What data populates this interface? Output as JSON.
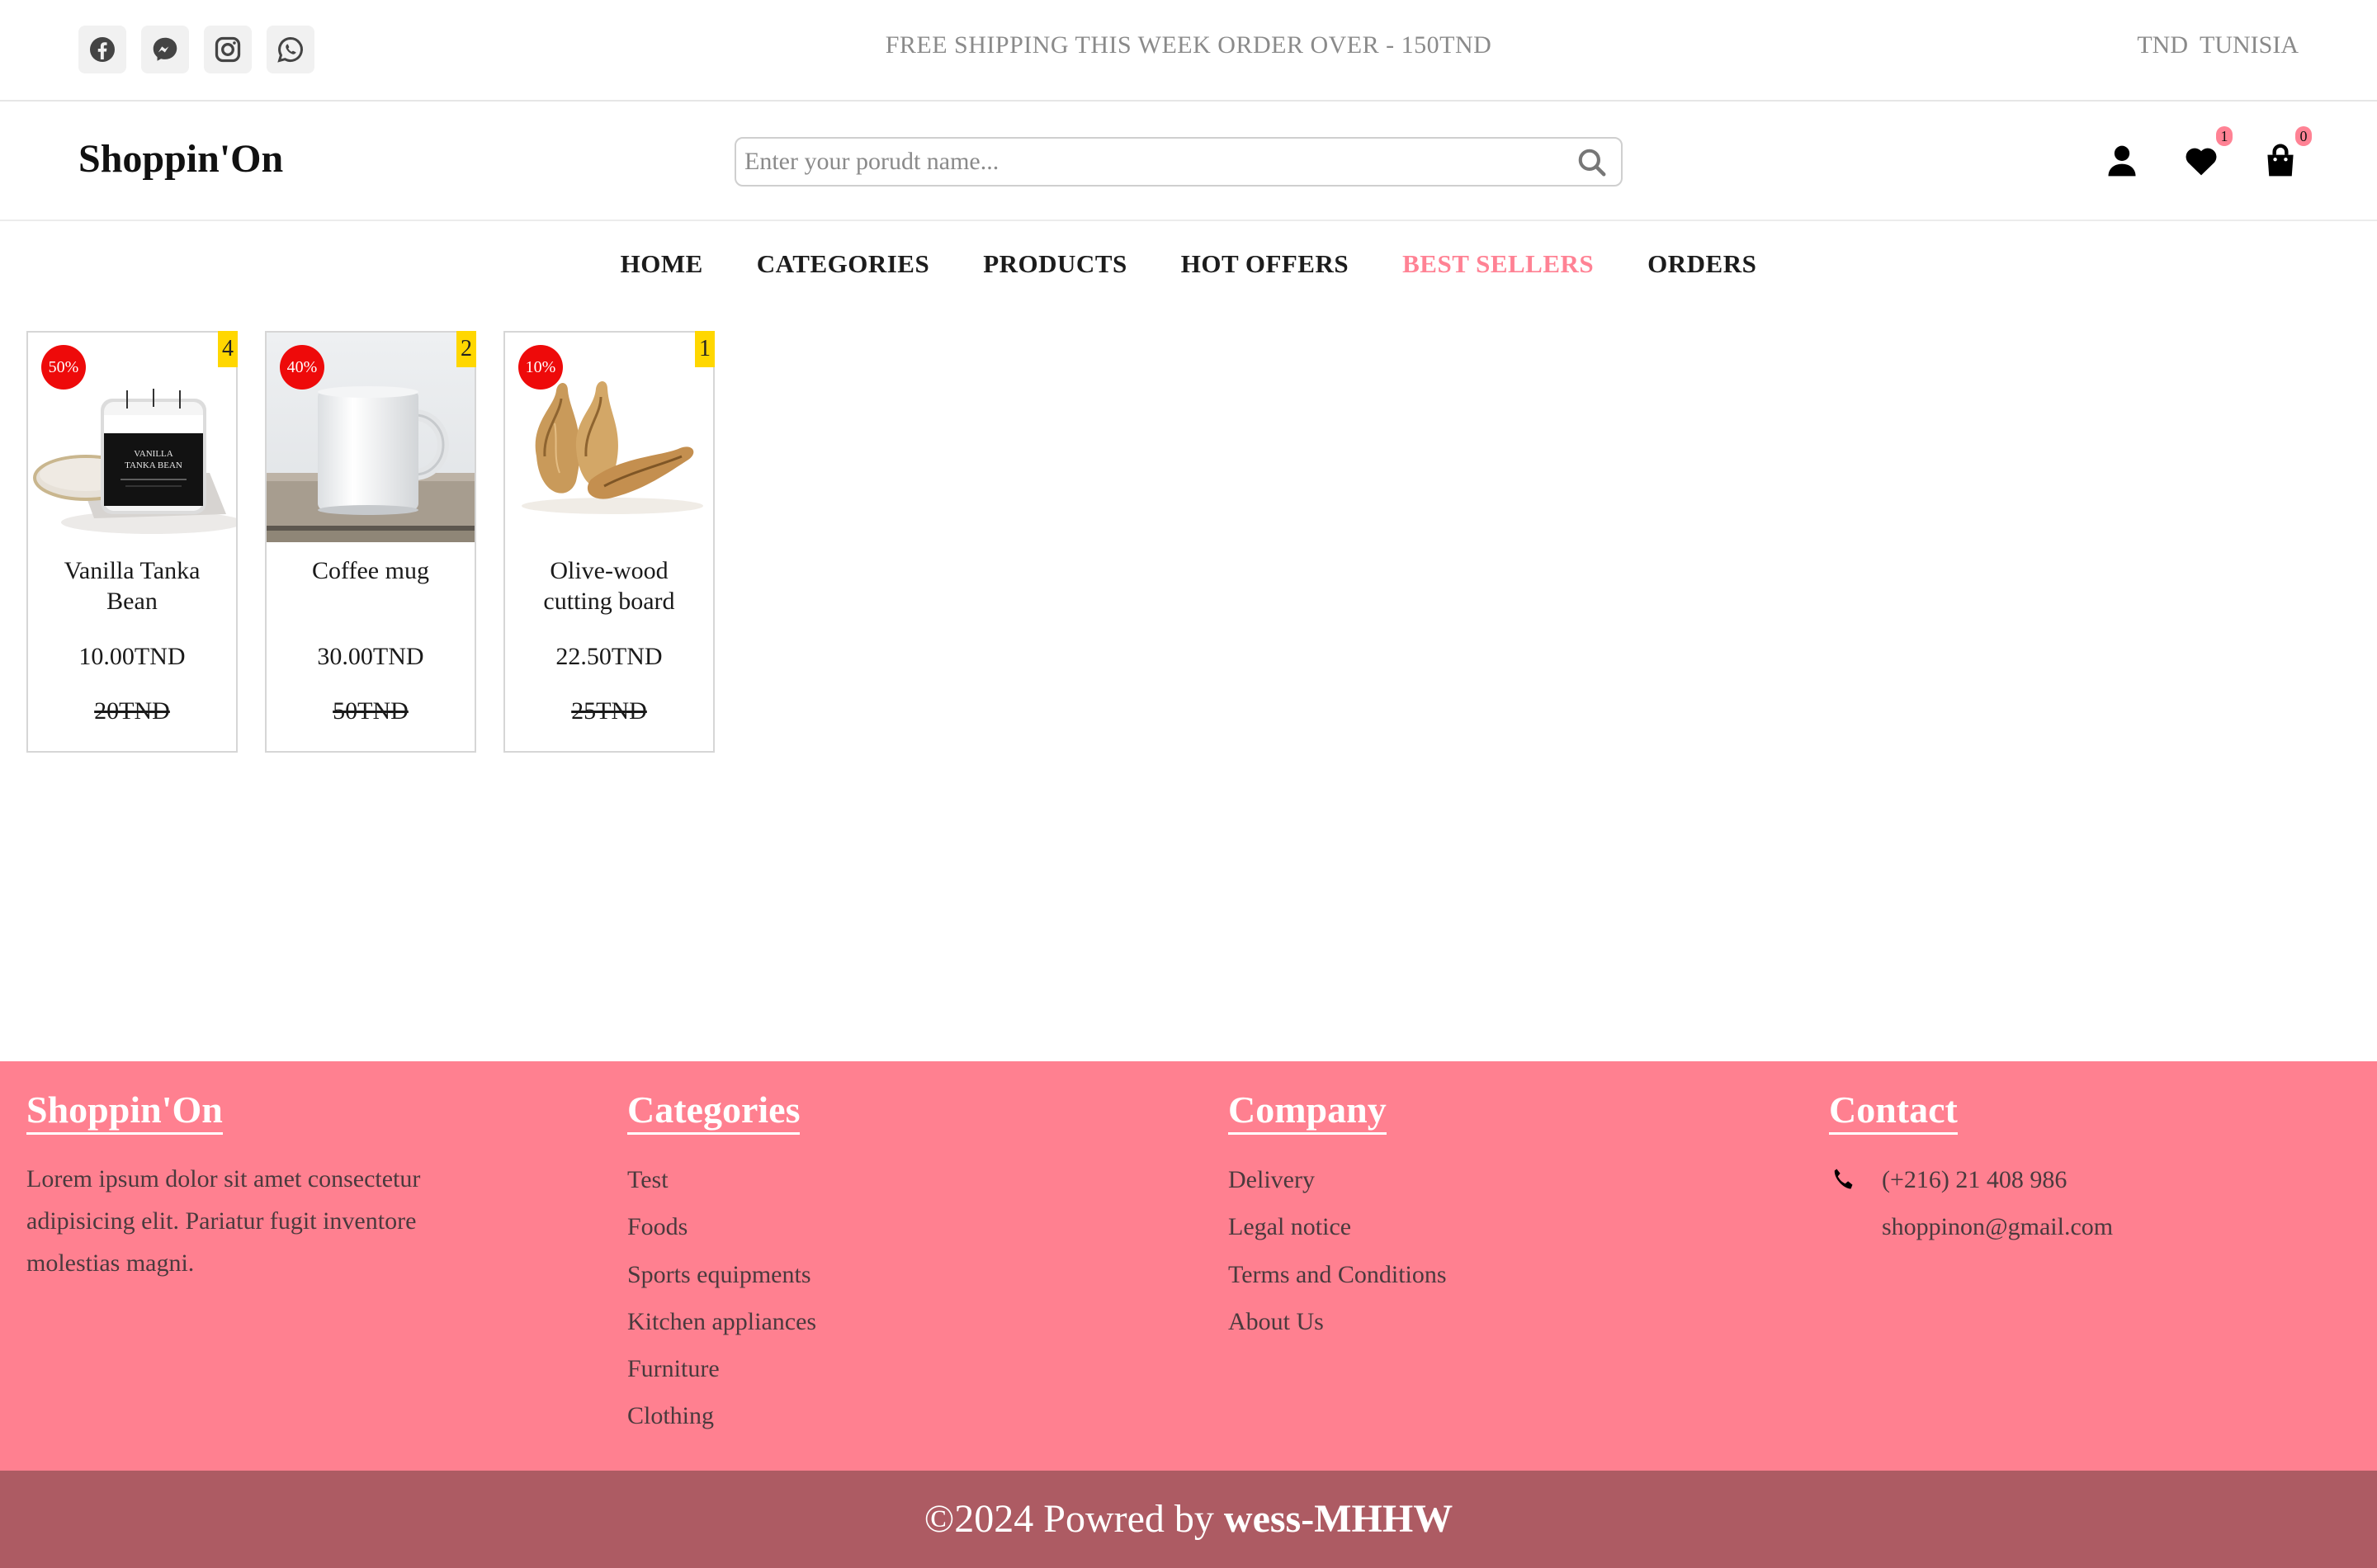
{
  "topbar": {
    "socials": [
      {
        "icon": "facebook-icon"
      },
      {
        "icon": "messenger-icon"
      },
      {
        "icon": "instagram-icon"
      },
      {
        "icon": "whatsapp-icon"
      }
    ],
    "promo": "FREE SHIPPING THIS WEEK ORDER OVER - 150TND",
    "currency": "TND",
    "country": "TUNISIA"
  },
  "header": {
    "logo": "Shoppin'On",
    "search_placeholder": "Enter your porudt name...",
    "wishlist_count": "1",
    "cart_count": "0"
  },
  "nav": {
    "items": [
      "HOME",
      "CATEGORIES",
      "PRODUCTS",
      "HOT OFFERS",
      "BEST SELLERS",
      "ORDERS"
    ],
    "active": "BEST SELLERS"
  },
  "products": [
    {
      "name": "Vanilla Tanka Bean",
      "price": "10.00TND",
      "old_price": "20TND",
      "discount": "50%",
      "rank": "4",
      "image_text_1": "VANILLA",
      "image_text_2": "TANKA BEAN"
    },
    {
      "name": "Coffee mug",
      "price": "30.00TND",
      "old_price": "50TND",
      "discount": "40%",
      "rank": "2"
    },
    {
      "name": "Olive-wood cutting board",
      "price": "22.50TND",
      "old_price": "25TND",
      "discount": "10%",
      "rank": "1"
    }
  ],
  "footer": {
    "brand": {
      "title": "Shoppin'On",
      "text": "Lorem ipsum dolor sit amet consectetur adipisicing elit. Pariatur fugit inventore molestias magni."
    },
    "categories": {
      "title": "Categories",
      "items": [
        "Test",
        "Foods",
        "Sports equipments",
        "Kitchen appliances",
        "Furniture",
        "Clothing"
      ]
    },
    "company": {
      "title": "Company",
      "items": [
        "Delivery",
        "Legal notice",
        "Terms and Conditions",
        "About Us"
      ]
    },
    "contact": {
      "title": "Contact",
      "phone": "(+216) 21 408 986",
      "email": "shoppinon@gmail.com"
    }
  },
  "copyright": {
    "prefix": "©2024 Powred by",
    "author": "wess-MHHW"
  },
  "colors": {
    "accent": "#ff8294",
    "footer_bg": "#ff8090",
    "copyright_bg": "#ad5b63",
    "discount_badge": "#ee0a0a",
    "rank_badge": "#ffd700"
  }
}
